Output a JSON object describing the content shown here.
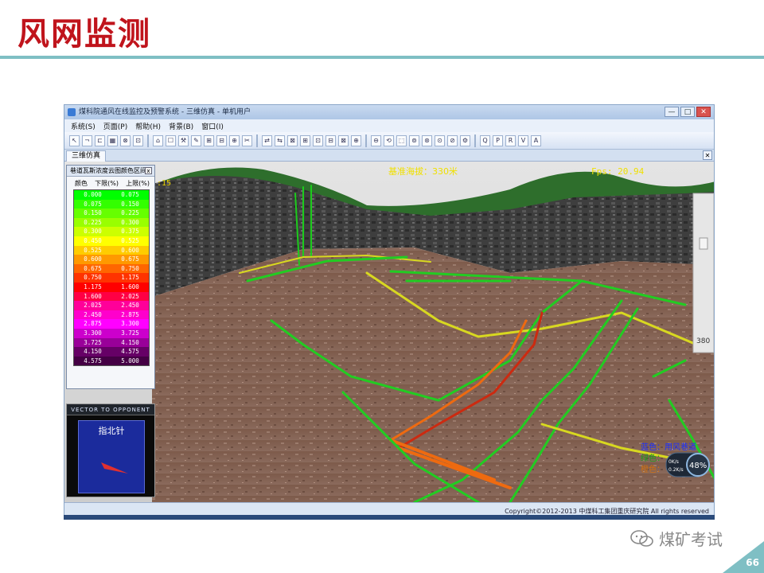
{
  "slide": {
    "title": "风网监测",
    "page_number": "66",
    "watermark": "煤矿考试",
    "accent_color": "#c0141c",
    "rule_color": "#7fbfc4"
  },
  "window": {
    "title": "煤科院通风在线监控及预警系统 - 三维仿真 - 单机用户",
    "minimize": "—",
    "maximize": "□",
    "close": "✕"
  },
  "menu": [
    "系统(S)",
    "页面(P)",
    "帮助(H)",
    "背景(B)",
    "窗口(I)"
  ],
  "toolbar_letters": [
    "Q",
    "P",
    "R",
    "V",
    "A"
  ],
  "doc_tab": {
    "label": "三维仿真",
    "close": "✕"
  },
  "hud": {
    "left_readout": ":15",
    "base_elevation": "基准海拔：330米",
    "fps": "Fps: 20.94",
    "slider_value": "380",
    "legend_items": [
      "蓝色：用风巷道",
      "绿色：",
      "橙色："
    ],
    "gauge_up": "0K/s",
    "gauge_down": "0.2K/s",
    "gauge_percent": "48%"
  },
  "legend": {
    "title": "巷道瓦斯浓度云图颜色区间",
    "close": "x",
    "columns": [
      "颜色",
      "下限(%)",
      "上限(%)"
    ],
    "rows": [
      {
        "lower": "0.000",
        "upper": "0.075",
        "color": "#00ff00"
      },
      {
        "lower": "0.075",
        "upper": "0.150",
        "color": "#33ff00"
      },
      {
        "lower": "0.150",
        "upper": "0.225",
        "color": "#66ff00"
      },
      {
        "lower": "0.225",
        "upper": "0.300",
        "color": "#99ff00"
      },
      {
        "lower": "0.300",
        "upper": "0.375",
        "color": "#ccff00"
      },
      {
        "lower": "0.450",
        "upper": "0.525",
        "color": "#ffff00"
      },
      {
        "lower": "0.525",
        "upper": "0.600",
        "color": "#ffcc00"
      },
      {
        "lower": "0.600",
        "upper": "0.675",
        "color": "#ff9900"
      },
      {
        "lower": "0.675",
        "upper": "0.750",
        "color": "#ff6600"
      },
      {
        "lower": "0.750",
        "upper": "1.175",
        "color": "#ff3300"
      },
      {
        "lower": "1.175",
        "upper": "1.600",
        "color": "#ff0000"
      },
      {
        "lower": "1.600",
        "upper": "2.025",
        "color": "#ff0044"
      },
      {
        "lower": "2.025",
        "upper": "2.450",
        "color": "#ff0099"
      },
      {
        "lower": "2.450",
        "upper": "2.875",
        "color": "#ff00cc"
      },
      {
        "lower": "2.875",
        "upper": "3.300",
        "color": "#ff00ff"
      },
      {
        "lower": "3.300",
        "upper": "3.725",
        "color": "#cc00cc"
      },
      {
        "lower": "3.725",
        "upper": "4.150",
        "color": "#990099"
      },
      {
        "lower": "4.150",
        "upper": "4.575",
        "color": "#660066"
      },
      {
        "lower": "4.575",
        "upper": "5.000",
        "color": "#440044"
      }
    ]
  },
  "compass": {
    "header": "VECTOR TO OPPONENT",
    "label": "指北针"
  },
  "status": {
    "copyright": "Copyright©2012-2013 中煤科工集团重庆研究院 All rights reserved"
  }
}
